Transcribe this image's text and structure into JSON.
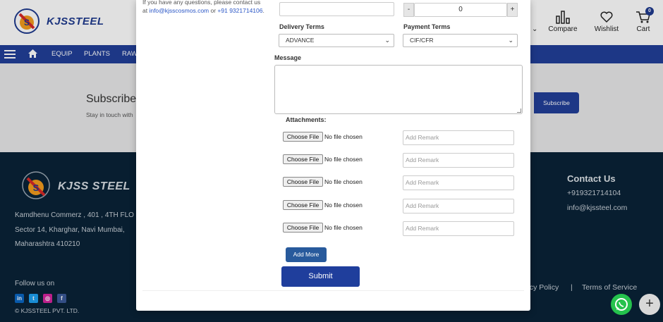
{
  "header": {
    "logo_text": "KJSSTEEL",
    "compare_label": "Compare",
    "wishlist_label": "Wishlist",
    "cart_label": "Cart",
    "cart_count": "0"
  },
  "nav": {
    "items": [
      "EQUIP",
      "PLANTS",
      "RAW"
    ]
  },
  "subscribe": {
    "title": "Subscribe",
    "text": "Stay in touch with",
    "button": "Subscribe"
  },
  "footer": {
    "logo_text": "KJSS STEEL",
    "address": [
      "Kamdhenu Commerz , 401 , 4TH FLO",
      "Sector 14, Kharghar, Navi Mumbai,",
      "Maharashtra 410210"
    ],
    "follow_label": "Follow us on",
    "copyright": "© KJSSTEEL PVT. LTD.",
    "contact_title": "Contact Us",
    "phone": "+919321714104",
    "email": "info@kjssteel.com",
    "privacy": "acy Policy",
    "separator": "|",
    "terms": "Terms of Service"
  },
  "modal": {
    "intro_prefix": "If you have any questions, please contact us at ",
    "intro_email": "info@kjsscosmos.com",
    "intro_mid": " or ",
    "intro_phone": "+91 9321714106",
    "intro_suffix": ".",
    "quantity_value": "0",
    "stepper_minus": "-",
    "stepper_plus": "+",
    "delivery_label": "Delivery Terms",
    "delivery_value": "ADVANCE",
    "payment_label": "Payment Terms",
    "payment_value": "CIF/CFR",
    "message_label": "Message",
    "attachments_label": "Attachments:",
    "file_button": "Choose File",
    "file_none": "No file chosen",
    "remark_placeholder": "Add Remark",
    "add_more": "Add More",
    "submit": "Submit"
  },
  "colors": {
    "brand_blue": "#223f99",
    "footer_bg": "#0a2337",
    "whatsapp_green": "#25c24d"
  }
}
